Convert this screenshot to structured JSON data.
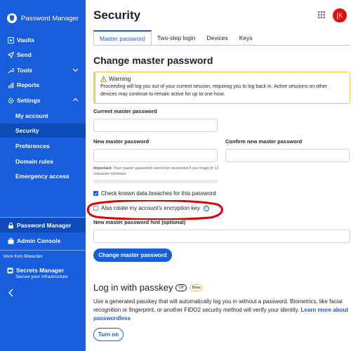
{
  "sidebar": {
    "brand": "Password Manager",
    "items": [
      {
        "label": "Vaults",
        "icon": "vault-icon"
      },
      {
        "label": "Send",
        "icon": "send-icon"
      },
      {
        "label": "Tools",
        "icon": "wrench-icon"
      },
      {
        "label": "Reports",
        "icon": "reports-icon"
      },
      {
        "label": "Settings",
        "icon": "gear-icon"
      }
    ],
    "settings_sub": [
      {
        "label": "My account"
      },
      {
        "label": "Security",
        "active": true
      },
      {
        "label": "Preferences"
      },
      {
        "label": "Domain rules"
      },
      {
        "label": "Emergency access"
      }
    ],
    "products": [
      {
        "label": "Password Manager",
        "icon": "lock-icon"
      },
      {
        "label": "Admin Console",
        "icon": "briefcase-icon"
      }
    ],
    "more_from": "More from Bitwarden",
    "secrets_manager": {
      "title": "Secrets Manager",
      "subtitle": "Secure your infrastructure"
    }
  },
  "header": {
    "title": "Security",
    "avatar_initials": "[K"
  },
  "tabs": [
    {
      "label": "Master password",
      "active": true
    },
    {
      "label": "Two-step login"
    },
    {
      "label": "Devices"
    },
    {
      "label": "Keys"
    }
  ],
  "change_pw": {
    "heading": "Change master password",
    "warning_title": "Warning",
    "warning_body": "Proceeding will log you out of your current session, requiring you to log back in. Active sessions on other devices may continue to remain active for up to one hour.",
    "current_label": "Current master password",
    "new_label": "New master password",
    "confirm_label": "Confirm new master password",
    "hint_important": "Important:",
    "hint_text": " Your master password cannot be recovered if you forget it! 12 character minimum",
    "check_breach": "Check known data breaches for this password",
    "rotate_key": "Also rotate my account's encryption key",
    "pw_hint_label": "New master password hint (optional)",
    "submit": "Change master password"
  },
  "passkey": {
    "heading": "Log in with passkey",
    "badge_off": "Off",
    "badge_beta": "Beta",
    "desc": "Use a generated passkey that will automatically log you in without a password. Biometrics, like facial recognition or fingerprint, or another FIDO2 security method will verify your identity. ",
    "link": "Learn more about passwordless",
    "button": "Turn on"
  },
  "colors": {
    "brand": "#175ddc",
    "warning": "#f5c75a",
    "avatar": "#e30f0f",
    "annotation": "#e00000"
  }
}
